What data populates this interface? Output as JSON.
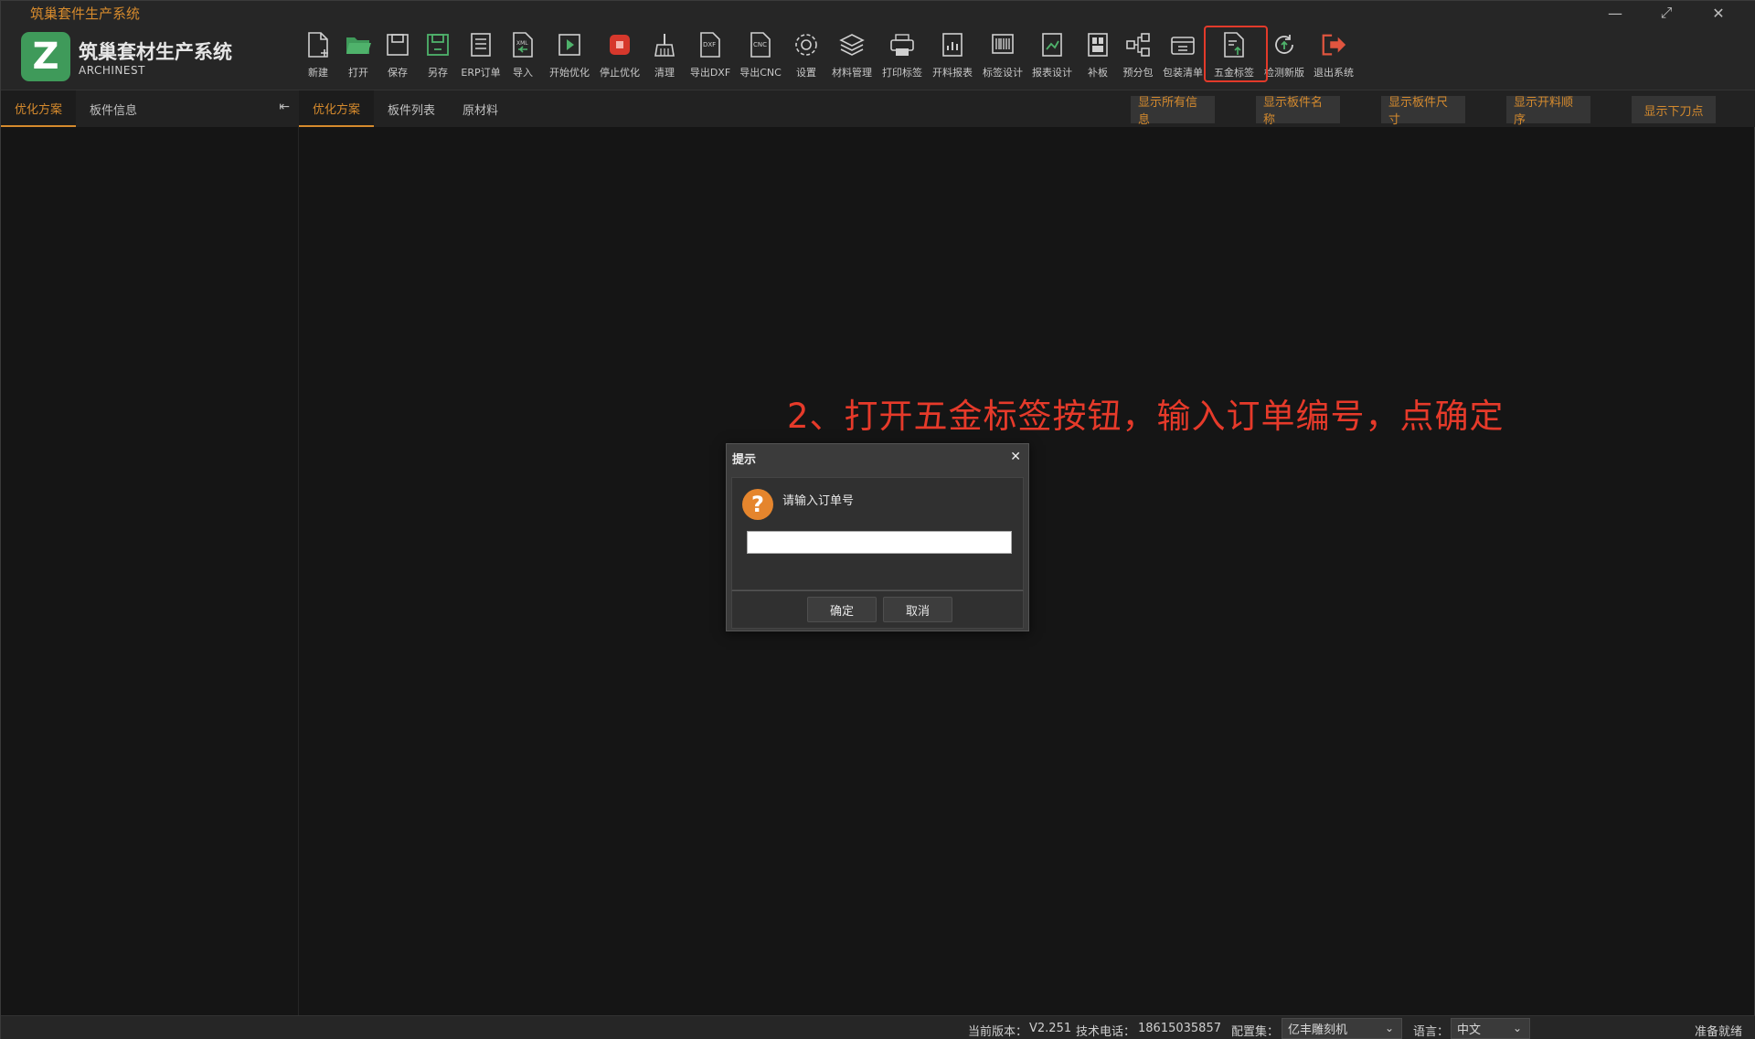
{
  "window": {
    "title": "筑巢套件生产系统",
    "minimize": "—",
    "maximize": "⤢",
    "close": "✕"
  },
  "brand": {
    "logo_letter": "Z",
    "name": "筑巢套材生产系统",
    "sub": "ARCHINEST"
  },
  "toolbar": [
    {
      "label": "新建",
      "icon": "new-file-icon"
    },
    {
      "label": "打开",
      "icon": "folder-open-icon"
    },
    {
      "label": "保存",
      "icon": "save-icon"
    },
    {
      "label": "另存",
      "icon": "save-as-icon"
    },
    {
      "label": "ERP订单",
      "icon": "erp-order-icon"
    },
    {
      "label": "导入",
      "icon": "import-xml-icon"
    },
    {
      "label": "开始优化",
      "icon": "play-icon"
    },
    {
      "label": "停止优化",
      "icon": "stop-icon"
    },
    {
      "label": "清理",
      "icon": "broom-icon"
    },
    {
      "label": "导出DXF",
      "icon": "export-dxf-icon"
    },
    {
      "label": "导出CNC",
      "icon": "export-cnc-icon"
    },
    {
      "label": "设置",
      "icon": "gear-icon"
    },
    {
      "label": "材料管理",
      "icon": "layers-icon"
    },
    {
      "label": "打印标签",
      "icon": "printer-icon"
    },
    {
      "label": "开料报表",
      "icon": "report-icon"
    },
    {
      "label": "标签设计",
      "icon": "barcode-icon"
    },
    {
      "label": "报表设计",
      "icon": "report-design-icon"
    },
    {
      "label": "补板",
      "icon": "patch-board-icon"
    },
    {
      "label": "预分包",
      "icon": "split-package-icon"
    },
    {
      "label": "包装清单",
      "icon": "package-list-icon"
    },
    {
      "label": "五金标签",
      "icon": "hardware-label-icon"
    },
    {
      "label": "检测新版",
      "icon": "update-check-icon"
    },
    {
      "label": "退出系统",
      "icon": "exit-icon"
    }
  ],
  "left_tabs": [
    {
      "label": "优化方案",
      "active": true
    },
    {
      "label": "板件信息",
      "active": false
    }
  ],
  "left_collapse": "⇤",
  "main_tabs": [
    {
      "label": "优化方案",
      "active": true
    },
    {
      "label": "板件列表",
      "active": false
    },
    {
      "label": "原材料",
      "active": false
    }
  ],
  "display_buttons": [
    "显示所有信息",
    "显示板件名称",
    "显示板件尺寸",
    "显示开料顺序",
    "显示下刀点"
  ],
  "annotation": "2、打开五金标签按钮，输入订单编号，点确定",
  "dialog": {
    "title": "提示",
    "close": "✕",
    "icon_glyph": "?",
    "prompt": "请输入订单号",
    "input_value": "",
    "ok": "确定",
    "cancel": "取消"
  },
  "status": {
    "version_label": "当前版本：",
    "version": "V2.251",
    "phone_label": "技术电话：",
    "phone": "18615035857",
    "config_label": "配置集：",
    "config_value": "亿丰雕刻机",
    "lang_label": "语言：",
    "lang_value": "中文",
    "state": "准备就绪"
  },
  "colors": {
    "accent": "#d58a2d",
    "brand_green": "#3f9a5a",
    "highlight_red": "#e33a2a",
    "annotation_red": "#e63a2a",
    "background": "#151515"
  }
}
